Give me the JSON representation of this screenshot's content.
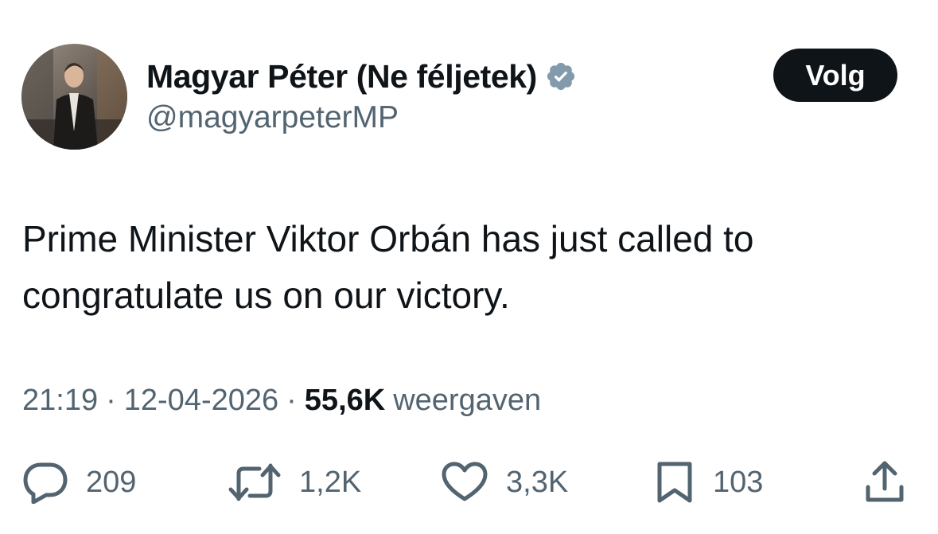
{
  "tweet": {
    "author": {
      "display_name": "Magyar Péter (Ne féljetek)",
      "handle": "@magyarpeterMP",
      "verified": true
    },
    "follow_label": "Volg",
    "text_lines": [
      "Prime Minister Viktor Orbán has just called to",
      "congratulate us on our victory."
    ],
    "meta": {
      "time": "21:19",
      "separator": "·",
      "date": "12-04-2026",
      "views_count": "55,6K",
      "views_label": "weergaven"
    },
    "actions": {
      "replies": "209",
      "reposts": "1,2K",
      "likes": "3,3K",
      "bookmarks": "103"
    }
  },
  "colors": {
    "text_primary": "#0f1419",
    "text_secondary": "#536471",
    "button_bg": "#0f1419",
    "verified_badge": "#829aab"
  },
  "icons": [
    "verified-badge-icon",
    "reply-icon",
    "repost-icon",
    "like-icon",
    "bookmark-icon",
    "share-icon"
  ]
}
